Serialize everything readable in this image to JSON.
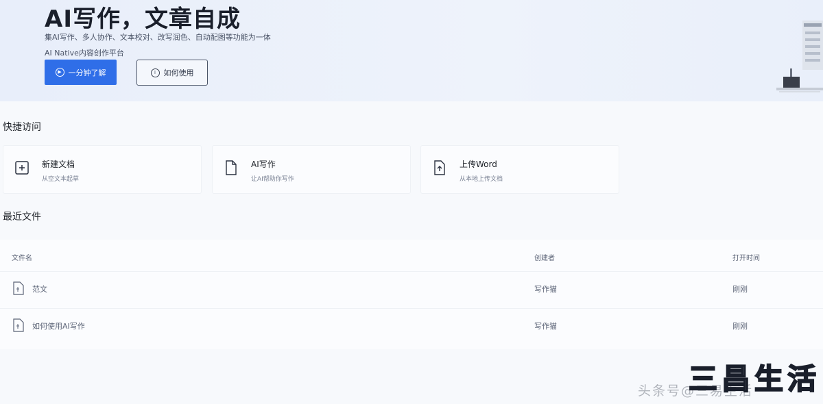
{
  "hero": {
    "title": "AI写作，文章自成",
    "subtitle_1": "集AI写作、多人协作、文本校对、改写润色、自动配图等功能为一体",
    "subtitle_2": "AI Native内容创作平台",
    "primary_button": "一分钟了解",
    "secondary_button": "如何使用",
    "primary_color": "#2f6ee8"
  },
  "quick_access": {
    "title": "快捷访问",
    "cards": [
      {
        "title": "新建文档",
        "desc": "从空文本起草",
        "icon": "add-document-icon"
      },
      {
        "title": "AI写作",
        "desc": "让AI帮助你写作",
        "icon": "document-icon"
      },
      {
        "title": "上传Word",
        "desc": "从本地上传文档",
        "icon": "upload-document-icon"
      }
    ]
  },
  "recent_files": {
    "title": "最近文件",
    "columns": [
      "文件名",
      "创建者",
      "打开时间"
    ],
    "rows": [
      {
        "name": "范文",
        "creator": "写作猫",
        "opened": "刚刚"
      },
      {
        "name": "如何使用AI写作",
        "creator": "写作猫",
        "opened": "刚刚"
      }
    ]
  },
  "watermark": {
    "large": "三昌生活",
    "small": "头条号@三易生活"
  }
}
